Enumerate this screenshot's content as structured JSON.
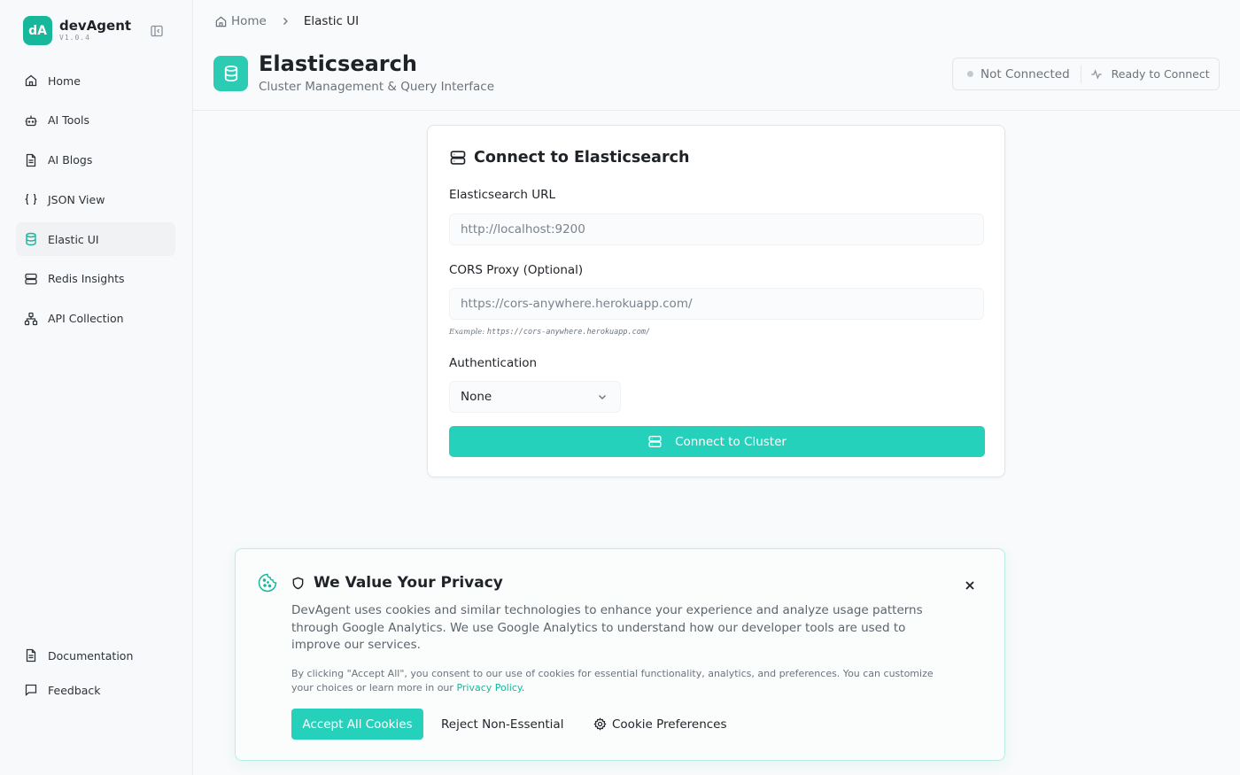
{
  "app": {
    "logo_text": "dA",
    "name": "devAgent",
    "version": "V1.0.4"
  },
  "sidebar": {
    "items": [
      {
        "label": "Home",
        "icon": "home-icon"
      },
      {
        "label": "AI Tools",
        "icon": "robot-icon"
      },
      {
        "label": "AI Blogs",
        "icon": "document-icon"
      },
      {
        "label": "JSON View",
        "icon": "braces-icon"
      },
      {
        "label": "Elastic UI",
        "icon": "database-icon",
        "active": true
      },
      {
        "label": "Redis Insights",
        "icon": "server-icon"
      },
      {
        "label": "API Collection",
        "icon": "network-icon"
      }
    ],
    "bottom_items": [
      {
        "label": "Documentation",
        "icon": "document-icon"
      },
      {
        "label": "Feedback",
        "icon": "message-icon"
      }
    ]
  },
  "breadcrumb": {
    "home": "Home",
    "current": "Elastic UI"
  },
  "header": {
    "title": "Elasticsearch",
    "subtitle": "Cluster Management & Query Interface"
  },
  "status": {
    "connection": "Not Connected",
    "ready": "Ready to Connect"
  },
  "connect_form": {
    "title": "Connect to Elasticsearch",
    "url_label": "Elasticsearch URL",
    "url_placeholder": "http://localhost:9200",
    "cors_label": "CORS Proxy (Optional)",
    "cors_placeholder": "https://cors-anywhere.herokuapp.com/",
    "cors_hint_prefix": "Example: ",
    "cors_hint_value": "https://cors-anywhere.herokuapp.com/",
    "auth_label": "Authentication",
    "auth_selected": "None",
    "connect_button": "Connect to Cluster"
  },
  "cookie_banner": {
    "title": "We Value Your Privacy",
    "description": "DevAgent uses cookies and similar technologies to enhance your experience and analyze usage patterns through Google Analytics. We use Google Analytics to understand how our developer tools are used to improve our services.",
    "fine_print": "By clicking \"Accept All\", you consent to our use of cookies for essential functionality, analytics, and preferences. You can customize your choices or learn more in our ",
    "privacy_link": "Privacy Policy",
    "fine_print_end": ".",
    "accept_button": "Accept All Cookies",
    "reject_button": "Reject Non-Essential",
    "prefs_button": "Cookie Preferences"
  },
  "colors": {
    "accent": "#26d1bc",
    "brand": "#17b79b"
  }
}
